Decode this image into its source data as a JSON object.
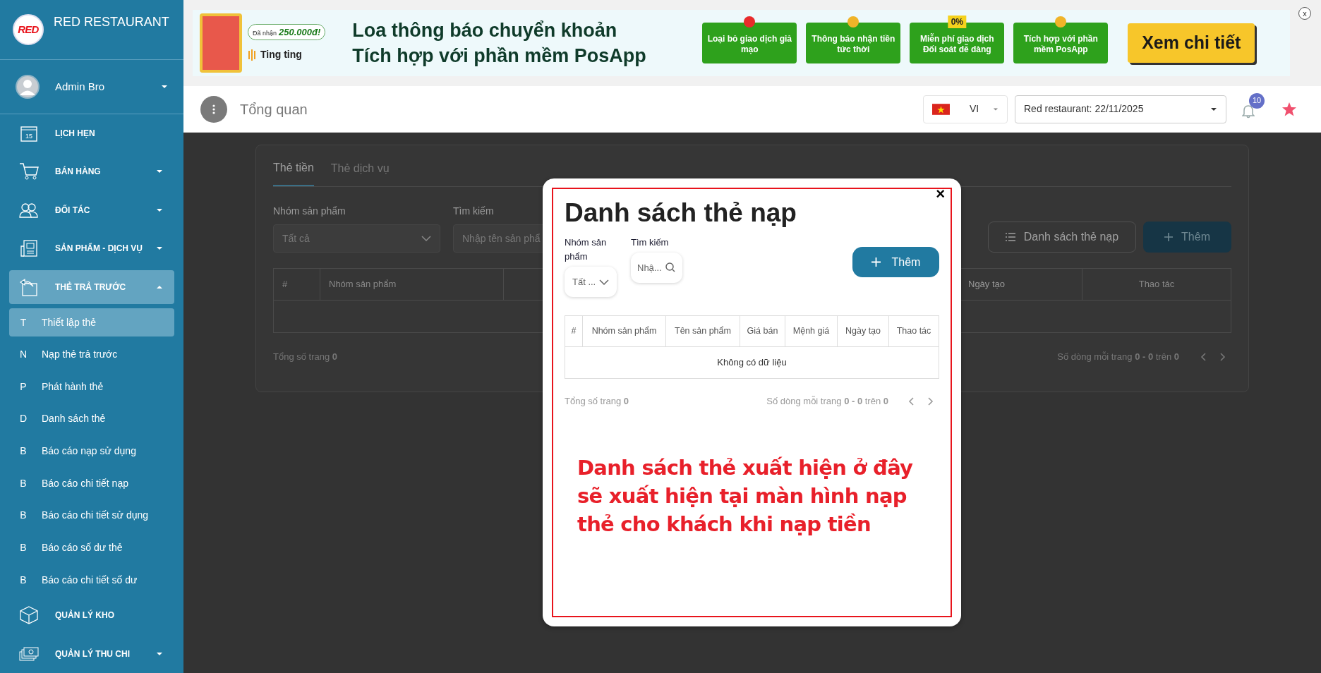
{
  "sidebar": {
    "logo_text": "RED",
    "brand": "RED RESTAURANT",
    "user": {
      "name": "Admin Bro"
    },
    "items": [
      {
        "kind": "section",
        "label": "LỊCH HẸN",
        "day": "15",
        "selected": false
      },
      {
        "kind": "section",
        "label": "BÁN HÀNG",
        "expanded": false,
        "selected": false
      },
      {
        "kind": "section",
        "label": "ĐỐI TÁC",
        "expanded": false,
        "selected": false
      },
      {
        "kind": "section",
        "label": "SẢN PHẨM - DỊCH VỤ",
        "expanded": false,
        "selected": false
      },
      {
        "kind": "section",
        "label": "THẺ TRẢ TRƯỚC",
        "expanded": true,
        "selected": true,
        "children": [
          {
            "letter": "T",
            "label": "Thiết lập thẻ",
            "selected": true
          },
          {
            "letter": "N",
            "label": "Nạp thẻ trả trước",
            "selected": false
          },
          {
            "letter": "P",
            "label": "Phát hành thẻ",
            "selected": false
          },
          {
            "letter": "D",
            "label": "Danh sách thẻ",
            "selected": false
          },
          {
            "letter": "B",
            "label": "Báo cáo nạp sử dụng",
            "selected": false
          },
          {
            "letter": "B",
            "label": "Báo cáo chi tiết nạp",
            "selected": false
          },
          {
            "letter": "B",
            "label": "Báo cáo chi tiết sử dụng",
            "selected": false
          },
          {
            "letter": "B",
            "label": "Báo cáo số dư thẻ",
            "selected": false
          },
          {
            "letter": "B",
            "label": "Báo cáo chi tiết số dư",
            "selected": false
          }
        ]
      },
      {
        "kind": "section",
        "label": "QUẢN LÝ KHO",
        "selected": false
      },
      {
        "kind": "section",
        "label": "QUẢN LÝ THU CHI",
        "expanded": false,
        "selected": false
      }
    ]
  },
  "banner": {
    "received_label": "Đã nhận",
    "amount": "250.000đ!",
    "brand": "Ting ting",
    "headline": [
      "Loa thông báo chuyển khoản",
      "Tích hợp với phần mềm PosApp"
    ],
    "features": [
      {
        "text": "Loại bỏ giao dịch giả mạo"
      },
      {
        "text": "Thông báo nhận tiền tức thời"
      },
      {
        "badge": "0%",
        "text": "Miễn phí giao dịch Đối soát dễ dàng"
      },
      {
        "text": "Tích hợp với phần mềm PosApp"
      }
    ],
    "cta": "Xem chi tiết",
    "close": "x"
  },
  "header": {
    "page_title": "Tổng quan",
    "language": "VI",
    "branch": "Red restaurant: 22/11/2025",
    "notifications": "10"
  },
  "page": {
    "tabs": [
      {
        "label": "Thẻ tiền",
        "selected": true
      },
      {
        "label": "Thẻ dịch vụ",
        "selected": false
      }
    ],
    "filters": [
      {
        "label": "Nhóm sản phẩm",
        "value": "Tất cả"
      },
      {
        "label": "Tìm kiếm",
        "placeholder": "Nhập tên sản phẩ"
      }
    ],
    "buttons": [
      {
        "kind": "list",
        "label": "Danh sách thẻ nạp"
      },
      {
        "kind": "add",
        "label": "Thêm"
      }
    ],
    "table": {
      "columns": [
        "#",
        "Nhóm sản phẩm",
        "Ngày tạo",
        "Thao tác"
      ]
    },
    "footer": {
      "total": "Tổng số trang **0**",
      "rows": "Số dòng mỗi trang **0 - 0** trên **0**"
    }
  },
  "modal": {
    "title": "Danh sách thẻ nạp",
    "close": "×",
    "filters": [
      {
        "label": "Nhóm sản phẩm",
        "value": "Tất ..."
      },
      {
        "label": "Tìm kiếm",
        "placeholder": "Nhậ..."
      }
    ],
    "add_button": "Thêm",
    "table": {
      "columns": [
        "#",
        "Nhóm sản phẩm",
        "Tên sản phẩm",
        "Giá bán",
        "Mệnh giá",
        "Ngày tạo",
        "Thao tác"
      ],
      "empty": "Không có dữ liệu"
    },
    "footer": {
      "total": "Tổng số trang **0**",
      "rows": "Số dòng mỗi trang **0 - 0** trên **0**"
    },
    "note": "Danh sách thẻ xuất hiện ở đây sẽ xuất hiện tại màn hình nạp thẻ cho khách khi nạp tiền"
  }
}
